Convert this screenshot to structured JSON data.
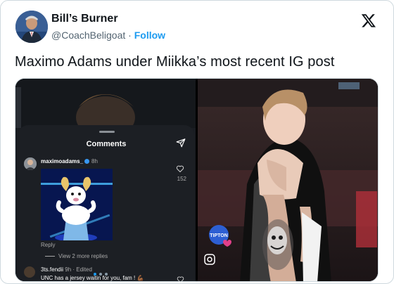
{
  "author": {
    "name": "Bill’s Burner",
    "handle": "@CoachBeligoat",
    "separator": "·",
    "follow_label": "Follow",
    "avatar_icon": "profile-photo"
  },
  "tweet": {
    "text": "Maximo Adams under Miikka’s most recent IG post"
  },
  "left_media": {
    "comments_panel": {
      "title": "Comments",
      "comment1": {
        "username": "maximoadams_",
        "time": "8h",
        "reply_label": "Reply",
        "view_replies": "View 2 more replies",
        "likes": "152"
      },
      "comment2": {
        "username": "3ts.fendii",
        "meta": "9h · Edited",
        "text": "UNC has a jersey waitin for you, fam ! 💪🏾"
      }
    }
  },
  "right_media": {
    "overlay_logo": "TIPTON",
    "carousel": {
      "count": 3,
      "active": 0
    }
  },
  "colors": {
    "accent": "#1d9bf0",
    "text_primary": "#0f1419",
    "text_secondary": "#536471",
    "border": "#cfd9de"
  }
}
